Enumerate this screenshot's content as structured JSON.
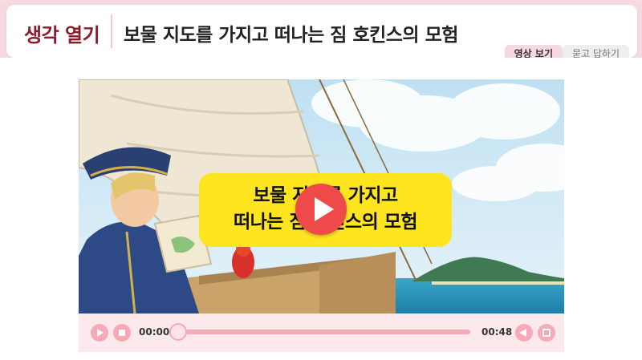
{
  "header": {
    "section_label": "생각 열기",
    "page_title": "보물 지도를 가지고 떠나는 짐 호킨스의 모험"
  },
  "tabs": [
    {
      "label": "영상 보기",
      "active": true
    },
    {
      "label": "묻고 답하기",
      "active": false
    }
  ],
  "video": {
    "caption_line1": "보물 지도를 가지고",
    "caption_line2": "떠나는 짐 호킨스의 모험",
    "current_time": "00:00",
    "total_time": "00:48",
    "progress": 0
  },
  "colors": {
    "accent": "#8b1a2a",
    "frame_pink": "#f6d9de",
    "control_pink": "#f7a9b5",
    "caption_yellow": "#ffe51f",
    "play_red": "#ef4a4a"
  },
  "icons": {
    "play": "play-icon",
    "stop": "stop-icon",
    "volume": "volume-icon",
    "fullscreen": "fullscreen-icon"
  }
}
